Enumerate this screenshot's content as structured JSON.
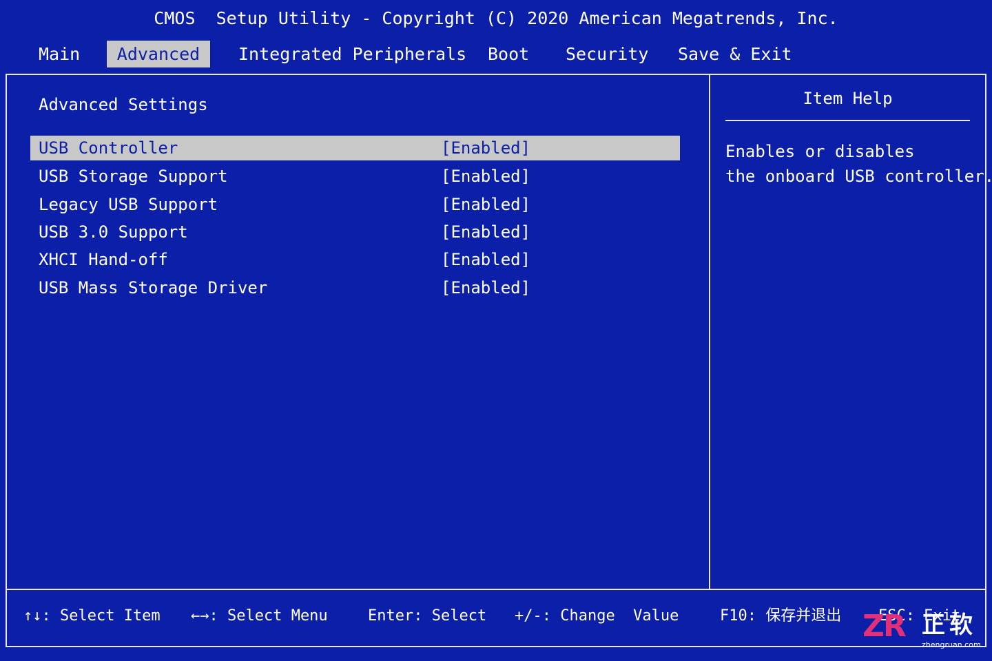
{
  "header": {
    "title": "CMOS  Setup Utility - Copyright (C) 2020 American Megatrends, Inc."
  },
  "menu": {
    "tabs": [
      {
        "label": "Main",
        "active": false
      },
      {
        "label": "Advanced",
        "active": true
      },
      {
        "label": "Integrated Peripherals",
        "active": false
      },
      {
        "label": "Boot",
        "active": false
      },
      {
        "label": "Security",
        "active": false
      },
      {
        "label": "Save & Exit",
        "active": false
      }
    ]
  },
  "settings": {
    "heading": "Advanced Settings",
    "selected_index": 0,
    "items": [
      {
        "label": "USB Controller",
        "value": "[Enabled]"
      },
      {
        "label": "USB Storage Support",
        "value": "[Enabled]"
      },
      {
        "label": "Legacy USB Support",
        "value": "[Enabled]"
      },
      {
        "label": "USB 3.0 Support",
        "value": "[Enabled]"
      },
      {
        "label": "XHCI Hand-off",
        "value": "[Enabled]"
      },
      {
        "label": "USB Mass Storage Driver",
        "value": "[Enabled]"
      }
    ]
  },
  "help": {
    "title": "Item Help",
    "lines": [
      "Enables or disables",
      "the onboard USB controller."
    ]
  },
  "footer": {
    "select_item": "↑↓: Select Item",
    "select_menu": "←→: Select Menu",
    "enter": "Enter: Select",
    "change_value": "+/-: Change  Value",
    "save_exit": "F10: 保存并退出",
    "esc": "ESC: Exit"
  },
  "watermark": {
    "logo": "ZR",
    "name": "正软",
    "url": "zhengruan.com"
  },
  "colors": {
    "background": "#0B1FA8",
    "highlight": "#C8C8C8",
    "text": "#FFFFFF",
    "logo_accent": "#E0307A"
  }
}
